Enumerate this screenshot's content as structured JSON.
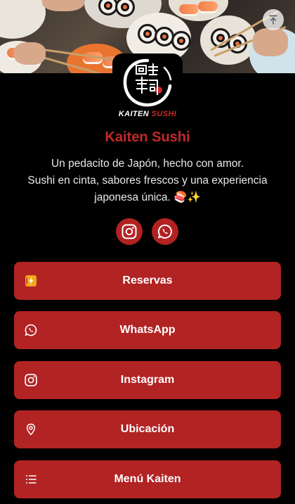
{
  "profile": {
    "name": "Kaiten Sushi",
    "bio": "Un pedacito de Japón, hecho con amor.\nSushi en cinta, sabores frescos y una experiencia japonesa única. 🍣✨",
    "logo_text_white": "KAITEN",
    "logo_text_red": "SUSHI",
    "logo_kanji": "回転寿司"
  },
  "social_icons": [
    {
      "name": "instagram-icon"
    },
    {
      "name": "whatsapp-icon"
    }
  ],
  "links": [
    {
      "label": "Reservas",
      "icon": "reservation-icon"
    },
    {
      "label": "WhatsApp",
      "icon": "whatsapp-icon"
    },
    {
      "label": "Instagram",
      "icon": "instagram-icon"
    },
    {
      "label": "Ubicación",
      "icon": "location-pin-icon"
    },
    {
      "label": "Menú Kaiten",
      "icon": "list-icon"
    }
  ],
  "colors": {
    "background": "#000000",
    "accent": "#b22323",
    "title": "#c3282a",
    "text": "#e8e8e8"
  }
}
